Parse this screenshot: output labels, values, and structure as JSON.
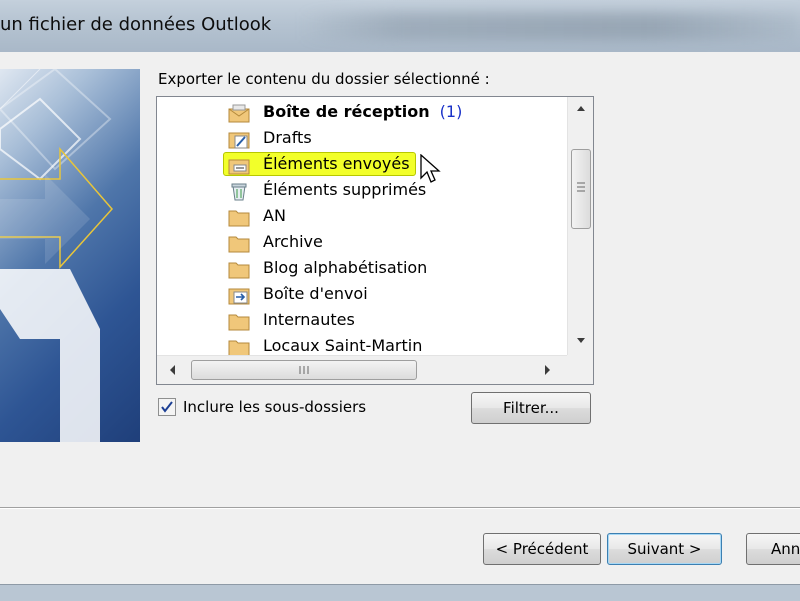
{
  "window": {
    "title": "un fichier de données Outlook"
  },
  "export_label": "Exporter le contenu du dossier sélectionné :",
  "folders": [
    {
      "name": "Boîte de réception",
      "count": "(1)",
      "icon": "inbox-icon",
      "bold": true
    },
    {
      "name": "Drafts",
      "icon": "drafts-icon"
    },
    {
      "name": "Éléments envoyés",
      "icon": "sent-items-icon",
      "highlighted": true
    },
    {
      "name": "Éléments supprimés",
      "icon": "trash-icon"
    },
    {
      "name": "AN",
      "icon": "folder-icon"
    },
    {
      "name": "Archive",
      "icon": "folder-icon"
    },
    {
      "name": "Blog alphabétisation",
      "icon": "folder-icon"
    },
    {
      "name": "Boîte d'envoi",
      "icon": "outbox-icon"
    },
    {
      "name": "Internautes",
      "icon": "folder-icon"
    },
    {
      "name": "Locaux Saint-Martin",
      "icon": "folder-icon"
    }
  ],
  "include_subfolders": {
    "label": "Inclure les sous-dossiers",
    "checked": true
  },
  "buttons": {
    "filter": "Filtrer...",
    "previous": "< Précédent",
    "next": "Suivant >",
    "cancel": "Ann"
  },
  "colors": {
    "highlight": "#f2ff2a",
    "count": "#1a32c8"
  }
}
